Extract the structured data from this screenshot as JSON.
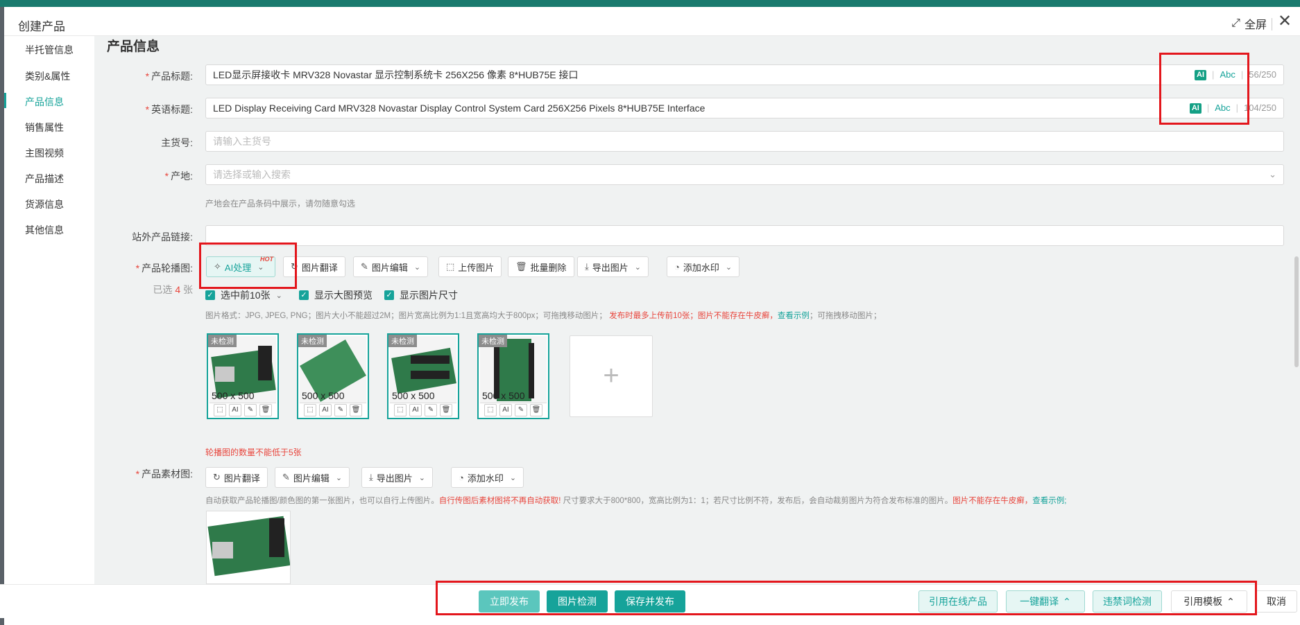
{
  "modal": {
    "title": "创建产品",
    "fullscreen_label": "全屏"
  },
  "sidebar": {
    "items": [
      {
        "label": "半托管信息"
      },
      {
        "label": "类别&属性"
      },
      {
        "label": "产品信息"
      },
      {
        "label": "销售属性"
      },
      {
        "label": "主图视频"
      },
      {
        "label": "产品描述"
      },
      {
        "label": "货源信息"
      },
      {
        "label": "其他信息"
      }
    ],
    "active_index": 2
  },
  "section": {
    "title": "产品信息"
  },
  "fields": {
    "product_title": {
      "label": "产品标题:",
      "value": "LED显示屏接收卡 MRV328 Novastar 显示控制系统卡 256X256 像素 8*HUB75E 接口",
      "ai": "AI",
      "abc": "Abc",
      "count": "56/250"
    },
    "english_title": {
      "label": "英语标题:",
      "value": "LED Display Receiving Card MRV328 Novastar Display Control System Card 256X256 Pixels 8*HUB75E Interface",
      "ai": "AI",
      "abc": "Abc",
      "count": "104/250"
    },
    "main_sku": {
      "label": "主货号:",
      "placeholder": "请输入主货号"
    },
    "origin": {
      "label": "产地:",
      "placeholder": "请选择或输入搜索",
      "hint": "产地会在产品条码中展示，请勿随意勾选"
    },
    "external_link": {
      "label": "站外产品链接:",
      "value": ""
    }
  },
  "carousel": {
    "label": "产品轮播图:",
    "selected_prefix": "已选",
    "selected_count": "4",
    "selected_suffix": "张",
    "toolbar": {
      "ai": "AI处理",
      "hot": "HOT",
      "translate": "图片翻译",
      "edit": "图片编辑",
      "upload": "上传图片",
      "batch_delete": "批量删除",
      "export": "导出图片",
      "watermark": "添加水印"
    },
    "checks": {
      "first10": "选中前10张",
      "preview": "显示大图预览",
      "size": "显示图片尺寸"
    },
    "hint_normal": "图片格式：JPG, JPEG, PNG；图片大小不能超过2M；图片宽高比例为1:1且宽高均大于800px；可拖拽移动图片；",
    "hint_red": "发布时最多上传前10张；图片不能存在牛皮癣，",
    "hint_link": "查看示例",
    "hint_tail": "；可拖拽移动图片；",
    "thumbs": [
      {
        "tag": "未检测",
        "dims": "500 x 500"
      },
      {
        "tag": "未检测",
        "dims": "500 x 500"
      },
      {
        "tag": "未检测",
        "dims": "500 x 500"
      },
      {
        "tag": "未检测",
        "dims": "500 x 500"
      }
    ],
    "thumb_ai": "AI",
    "warning": "轮播图的数量不能低于5张"
  },
  "material": {
    "label": "产品素材图:",
    "toolbar": {
      "translate": "图片翻译",
      "edit": "图片编辑",
      "export": "导出图片",
      "watermark": "添加水印"
    },
    "hint_normal": "自动获取产品轮播图/颜色图的第一张图片，也可以自行上传图片。",
    "hint_red": "自行传图后素材图将不再自动获取!",
    "hint_mid": " 尺寸要求大于800*800，宽高比例为1：1；若尺寸比例不符，发布后，会自动裁剪图片为符合发布标准的图片。",
    "hint_red2": "图片不能存在牛皮癣，",
    "hint_link": "查看示例;"
  },
  "footer": {
    "publish_now": "立即发布",
    "image_check": "图片检测",
    "save_publish": "保存并发布",
    "use_online": "引用在线产品",
    "one_click_translate": "一键翻译",
    "banned_words": "违禁词检测",
    "use_template": "引用模板",
    "cancel": "取消"
  },
  "colors": {
    "accent": "#16a39a",
    "danger": "#e8453c",
    "highlight_box": "#e3161c"
  }
}
